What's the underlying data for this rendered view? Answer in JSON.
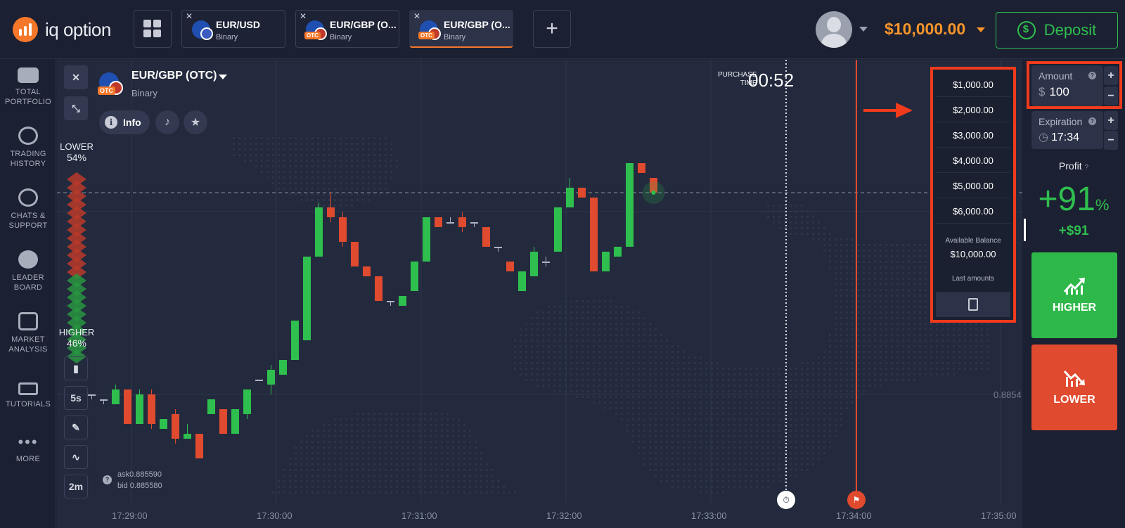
{
  "brand": {
    "name": "iq option"
  },
  "tabs": [
    {
      "name": "EUR/USD",
      "type": "Binary",
      "otc": false
    },
    {
      "name": "EUR/GBP (O...",
      "type": "Binary",
      "otc": true
    },
    {
      "name": "EUR/GBP (O...",
      "type": "Binary",
      "otc": true
    }
  ],
  "otc_badge": "OTC",
  "account": {
    "balance": "$10,000.00",
    "deposit_label": "Deposit"
  },
  "nav": [
    {
      "label": "TOTAL PORTFOLIO",
      "icon": "briefcase-icon"
    },
    {
      "label": "TRADING HISTORY",
      "icon": "history-icon"
    },
    {
      "label": "CHATS & SUPPORT",
      "icon": "chat-icon"
    },
    {
      "label": "LEADER BOARD",
      "icon": "medal-icon"
    },
    {
      "label": "MARKET ANALYSIS",
      "icon": "news-icon"
    },
    {
      "label": "TUTORIALS",
      "icon": "graduation-cap-icon"
    },
    {
      "label": "MORE",
      "icon": "more-icon"
    }
  ],
  "asset": {
    "title": "EUR/GBP (OTC)",
    "type": "Binary",
    "info_label": "Info"
  },
  "sentiment": {
    "lower_label": "LOWER",
    "lower_pct": "54%",
    "higher_label": "HIGHER",
    "higher_pct": "46%"
  },
  "purchase": {
    "label_line1": "PURCHASE",
    "label_line2": "TIME",
    "timer": "00:52"
  },
  "tools": {
    "period": "5s",
    "timeframe": "2m"
  },
  "quote": {
    "ask": "ask0.885590",
    "bid": "bid 0.885580"
  },
  "price_axis_label": "0.8854",
  "time_axis": [
    "17:29:00",
    "17:30:00",
    "17:31:00",
    "17:32:00",
    "17:33:00",
    "17:34:00",
    "17:35:00"
  ],
  "amount_dropdown": {
    "options": [
      "$1,000.00",
      "$2,000.00",
      "$3,000.00",
      "$4,000.00",
      "$5,000.00",
      "$6,000.00"
    ],
    "available_balance_label": "Available Balance",
    "available_balance": "$10,000.00",
    "last_amounts_label": "Last amounts"
  },
  "trade": {
    "amount_label": "Amount",
    "amount_currency": "$",
    "amount_value": "100",
    "expiration_label": "Expiration",
    "expiration_value": "17:34",
    "profit_label": "Profit",
    "profit_pct": "+91",
    "profit_pct_unit": "%",
    "profit_amount": "+$91",
    "higher_label": "HIGHER",
    "lower_label": "LOWER"
  },
  "colors": {
    "up": "#2fbf4f",
    "down": "#e04a2f",
    "accent": "#f5782a",
    "highlight": "#f03a1c"
  },
  "candles": [
    {
      "o": 0.88542,
      "c": 0.88542,
      "h": 0.88542,
      "l": 0.88541
    },
    {
      "o": 0.88541,
      "c": 0.88541,
      "h": 0.88541,
      "l": 0.8854
    },
    {
      "o": 0.8854,
      "c": 0.88543,
      "h": 0.88544,
      "l": 0.8854
    },
    {
      "o": 0.88543,
      "c": 0.88536,
      "h": 0.88543,
      "l": 0.88536
    },
    {
      "o": 0.88536,
      "c": 0.88542,
      "h": 0.88543,
      "l": 0.88536
    },
    {
      "o": 0.88542,
      "c": 0.88536,
      "h": 0.88543,
      "l": 0.88535
    },
    {
      "o": 0.88535,
      "c": 0.88537,
      "h": 0.88537,
      "l": 0.88535
    },
    {
      "o": 0.88538,
      "c": 0.88533,
      "h": 0.88539,
      "l": 0.88532
    },
    {
      "o": 0.88533,
      "c": 0.88534,
      "h": 0.88536,
      "l": 0.88533
    },
    {
      "o": 0.88534,
      "c": 0.88529,
      "h": 0.88534,
      "l": 0.88529
    },
    {
      "o": 0.88538,
      "c": 0.88541,
      "h": 0.88541,
      "l": 0.88538
    },
    {
      "o": 0.88539,
      "c": 0.88534,
      "h": 0.88539,
      "l": 0.88534
    },
    {
      "o": 0.88534,
      "c": 0.88539,
      "h": 0.88539,
      "l": 0.88534
    },
    {
      "o": 0.88538,
      "c": 0.88543,
      "h": 0.88543,
      "l": 0.88537
    },
    {
      "o": 0.88545,
      "c": 0.88545,
      "h": 0.88545,
      "l": 0.88545
    },
    {
      "o": 0.88544,
      "c": 0.88547,
      "h": 0.88548,
      "l": 0.88542
    },
    {
      "o": 0.88546,
      "c": 0.88549,
      "h": 0.88549,
      "l": 0.88546
    },
    {
      "o": 0.88549,
      "c": 0.88557,
      "h": 0.88557,
      "l": 0.88549
    },
    {
      "o": 0.88553,
      "c": 0.8857,
      "h": 0.8857,
      "l": 0.88553
    },
    {
      "o": 0.8857,
      "c": 0.8858,
      "h": 0.88581,
      "l": 0.8857
    },
    {
      "o": 0.8858,
      "c": 0.88578,
      "h": 0.88583,
      "l": 0.88577
    },
    {
      "o": 0.88578,
      "c": 0.88573,
      "h": 0.88579,
      "l": 0.88572
    },
    {
      "o": 0.88573,
      "c": 0.88568,
      "h": 0.88573,
      "l": 0.88568
    },
    {
      "o": 0.88568,
      "c": 0.88566,
      "h": 0.88568,
      "l": 0.88566
    },
    {
      "o": 0.88566,
      "c": 0.88561,
      "h": 0.88566,
      "l": 0.88561
    },
    {
      "o": 0.88561,
      "c": 0.88561,
      "h": 0.88561,
      "l": 0.8856
    },
    {
      "o": 0.8856,
      "c": 0.88562,
      "h": 0.88562,
      "l": 0.8856
    },
    {
      "o": 0.88563,
      "c": 0.88569,
      "h": 0.88569,
      "l": 0.88563
    },
    {
      "o": 0.88569,
      "c": 0.88578,
      "h": 0.88578,
      "l": 0.88569
    },
    {
      "o": 0.88578,
      "c": 0.88576,
      "h": 0.88578,
      "l": 0.88576
    },
    {
      "o": 0.88577,
      "c": 0.88577,
      "h": 0.88578,
      "l": 0.88577
    },
    {
      "o": 0.88578,
      "c": 0.88576,
      "h": 0.88579,
      "l": 0.88575
    },
    {
      "o": 0.88577,
      "c": 0.88577,
      "h": 0.88577,
      "l": 0.88576
    },
    {
      "o": 0.88576,
      "c": 0.88572,
      "h": 0.88576,
      "l": 0.88572
    },
    {
      "o": 0.88572,
      "c": 0.88572,
      "h": 0.88572,
      "l": 0.88571
    },
    {
      "o": 0.88569,
      "c": 0.88567,
      "h": 0.88569,
      "l": 0.88567
    },
    {
      "o": 0.88563,
      "c": 0.88567,
      "h": 0.88567,
      "l": 0.88563
    },
    {
      "o": 0.88566,
      "c": 0.88571,
      "h": 0.88572,
      "l": 0.88566
    },
    {
      "o": 0.88569,
      "c": 0.88569,
      "h": 0.8857,
      "l": 0.88568
    },
    {
      "o": 0.88571,
      "c": 0.8858,
      "h": 0.8858,
      "l": 0.88571
    },
    {
      "o": 0.8858,
      "c": 0.88584,
      "h": 0.88586,
      "l": 0.8858
    },
    {
      "o": 0.88584,
      "c": 0.88582,
      "h": 0.88584,
      "l": 0.88582
    },
    {
      "o": 0.88582,
      "c": 0.88567,
      "h": 0.88582,
      "l": 0.88567
    },
    {
      "o": 0.88567,
      "c": 0.88571,
      "h": 0.88571,
      "l": 0.88567
    },
    {
      "o": 0.8857,
      "c": 0.88572,
      "h": 0.88572,
      "l": 0.8857
    },
    {
      "o": 0.88572,
      "c": 0.88589,
      "h": 0.88589,
      "l": 0.88572
    },
    {
      "o": 0.88589,
      "c": 0.88587,
      "h": 0.88589,
      "l": 0.88587
    },
    {
      "o": 0.88586,
      "c": 0.88583,
      "h": 0.88586,
      "l": 0.88583
    }
  ]
}
